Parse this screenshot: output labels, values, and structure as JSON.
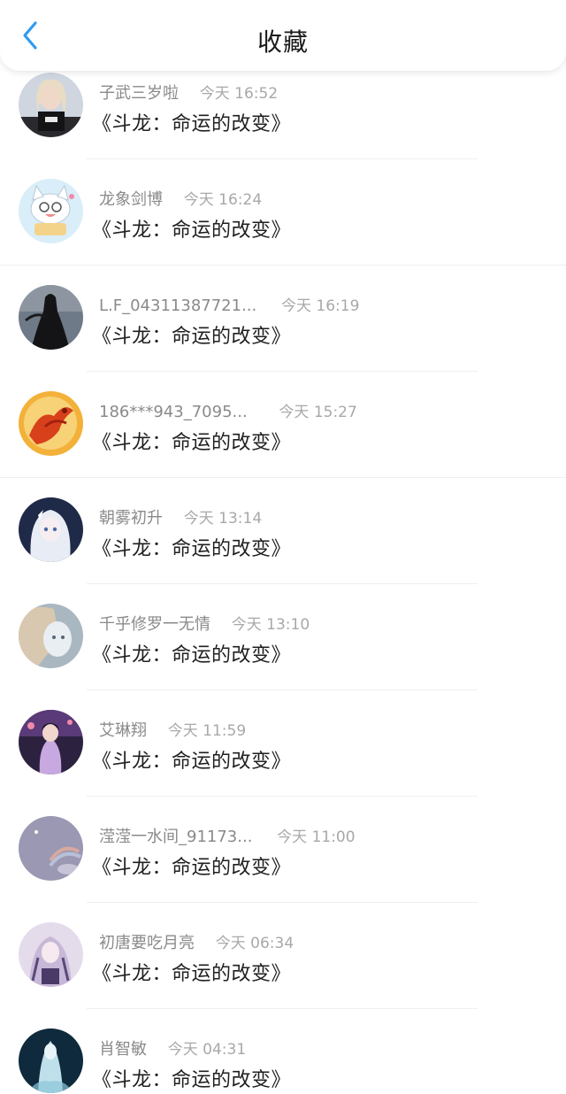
{
  "header": {
    "title": "收藏",
    "back_icon": "chevron-left-icon",
    "accent": "#2f9bf0"
  },
  "items": [
    {
      "user": "子武三岁啦",
      "time": "今天 16:52",
      "book": "《斗龙：命运的改变》"
    },
    {
      "user": "龙象剑博",
      "time": "今天 16:24",
      "book": "《斗龙：命运的改变》"
    },
    {
      "user": "L.F_04311387721...",
      "time": "今天 16:19",
      "book": "《斗龙：命运的改变》"
    },
    {
      "user": "186***943_7095...",
      "time": "今天 15:27",
      "book": "《斗龙：命运的改变》"
    },
    {
      "user": "朝雾初升",
      "time": "今天 13:14",
      "book": "《斗龙：命运的改变》"
    },
    {
      "user": "千乎修罗一无情",
      "time": "今天 13:10",
      "book": "《斗龙：命运的改变》"
    },
    {
      "user": "艾琳翔",
      "time": "今天 11:59",
      "book": "《斗龙：命运的改变》"
    },
    {
      "user": "滢滢一水间_91173...",
      "time": "今天 11:00",
      "book": "《斗龙：命运的改变》"
    },
    {
      "user": "初唐要吃月亮",
      "time": "今天 06:34",
      "book": "《斗龙：命运的改变》"
    },
    {
      "user": "肖智敏",
      "time": "今天 04:31",
      "book": "《斗龙：命运的改变》"
    }
  ]
}
